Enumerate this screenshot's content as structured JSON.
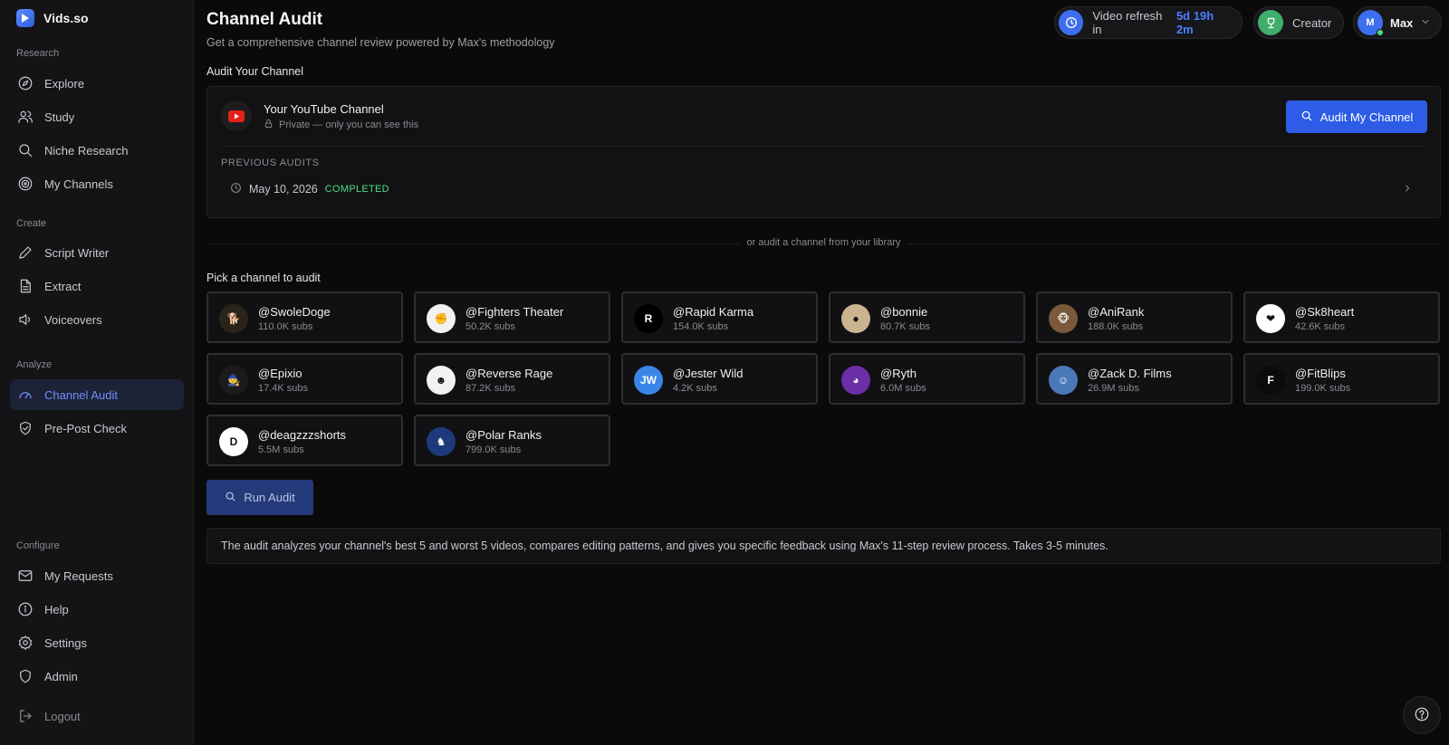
{
  "brand": {
    "name": "Vids.so"
  },
  "sidebar": {
    "sections": {
      "research": "Research",
      "create": "Create",
      "analyze": "Analyze",
      "configure": "Configure"
    },
    "items": {
      "explore": "Explore",
      "study": "Study",
      "niche_research": "Niche Research",
      "my_channels": "My Channels",
      "script_writer": "Script Writer",
      "extract": "Extract",
      "voiceovers": "Voiceovers",
      "channel_audit": "Channel Audit",
      "pre_post_check": "Pre-Post Check",
      "my_requests": "My Requests",
      "help": "Help",
      "settings": "Settings",
      "admin": "Admin",
      "logout": "Logout"
    },
    "active": "channel_audit"
  },
  "header": {
    "title": "Channel Audit",
    "subtitle": "Get a comprehensive channel review powered by Max's methodology",
    "refresh_label": "Video refresh in",
    "refresh_time": "5d 19h 2m",
    "plan": "Creator",
    "user_initial": "M",
    "user_name": "Max"
  },
  "audit_section": {
    "heading": "Audit Your Channel",
    "channel_title": "Your YouTube Channel",
    "privacy_note": "Private — only you can see this",
    "audit_button": "Audit My Channel",
    "previous_label": "PREVIOUS AUDITS",
    "previous": [
      {
        "date": "May 10, 2026",
        "status": "COMPLETED"
      }
    ]
  },
  "divider_text": "or audit a channel from your library",
  "pick_heading": "Pick a channel to audit",
  "channels": [
    {
      "handle": "@SwoleDoge",
      "subs": "110.0K subs",
      "avatar_color": "#2a2418",
      "avatar_glyph": "🐕"
    },
    {
      "handle": "@Fighters Theater",
      "subs": "50.2K subs",
      "avatar_color": "#f2f2f2",
      "avatar_glyph": "✊"
    },
    {
      "handle": "@Rapid Karma",
      "subs": "154.0K subs",
      "avatar_color": "#000000",
      "avatar_glyph": "R"
    },
    {
      "handle": "@bonnie",
      "subs": "80.7K subs",
      "avatar_color": "#c9b48f",
      "avatar_glyph": "●"
    },
    {
      "handle": "@AniRank",
      "subs": "188.0K subs",
      "avatar_color": "#7a5a3a",
      "avatar_glyph": "🐵"
    },
    {
      "handle": "@Sk8heart",
      "subs": "42.6K subs",
      "avatar_color": "#ffffff",
      "avatar_glyph": "❤"
    },
    {
      "handle": "@Epixio",
      "subs": "17.4K subs",
      "avatar_color": "#1b1b1b",
      "avatar_glyph": "🧙"
    },
    {
      "handle": "@Reverse Rage",
      "subs": "87.2K subs",
      "avatar_color": "#f2f2f2",
      "avatar_glyph": "☻"
    },
    {
      "handle": "@Jester Wild",
      "subs": "4.2K subs",
      "avatar_color": "#3a86e8",
      "avatar_glyph": "JW"
    },
    {
      "handle": "@Ryth",
      "subs": "6.0M subs",
      "avatar_color": "#6d2ea8",
      "avatar_glyph": "◕"
    },
    {
      "handle": "@Zack D. Films",
      "subs": "26.9M subs",
      "avatar_color": "#4a78b8",
      "avatar_glyph": "☺"
    },
    {
      "handle": "@FitBlips",
      "subs": "199.0K subs",
      "avatar_color": "#0b0b0b",
      "avatar_glyph": "F"
    },
    {
      "handle": "@deagzzzshorts",
      "subs": "5.5M subs",
      "avatar_color": "#ffffff",
      "avatar_glyph": "D"
    },
    {
      "handle": "@Polar Ranks",
      "subs": "799.0K subs",
      "avatar_color": "#1f3a7a",
      "avatar_glyph": "♞"
    }
  ],
  "run_button": "Run Audit",
  "info_text": "The audit analyzes your channel's best 5 and worst 5 videos, compares editing patterns, and gives you specific feedback using Max's 11-step review process. Takes 3-5 minutes.",
  "colors": {
    "accent": "#2d5ce6",
    "accent_text": "#4f7dff",
    "success": "#4ade80",
    "background": "#0a0a0b",
    "sidebar": "#141416"
  }
}
